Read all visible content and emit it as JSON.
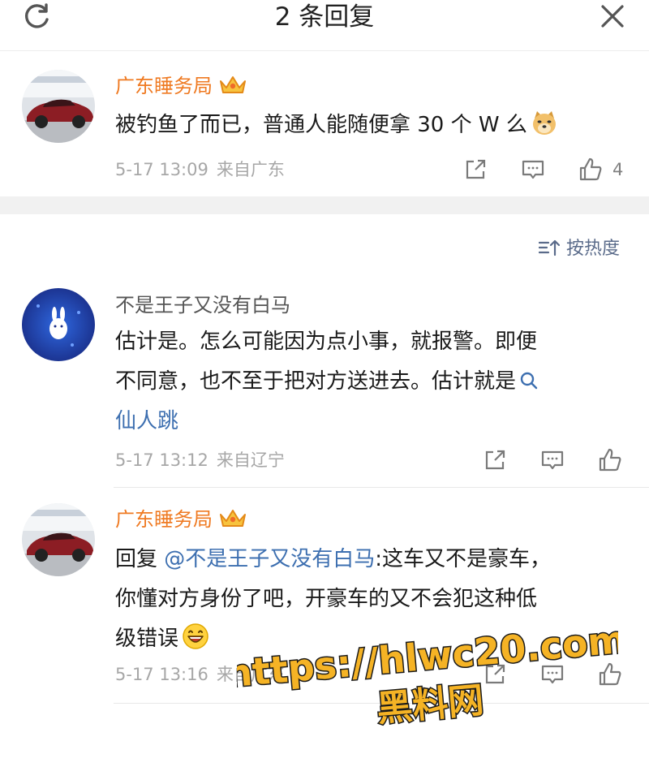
{
  "header": {
    "title": "2 条回复"
  },
  "main_comment": {
    "username": "广东睡务局",
    "text": "被钓鱼了而已，普通人能随便拿 30 个 W 么",
    "time": "5-17 13:09",
    "source": "来自广东",
    "like_count": "4"
  },
  "sort": {
    "label": "按热度"
  },
  "replies": [
    {
      "username": "不是王子又没有白马",
      "text_line1": "估计是。怎么可能因为点小事，就报警。即便",
      "text_line2": "不同意，也不至于把对方送进去。估计就是",
      "search_link": "仙人跳",
      "time": "5-17 13:12",
      "source": "来自辽宁"
    },
    {
      "username": "广东睡务局",
      "reply_prefix": "回复",
      "mention": "@不是王子又没有白马",
      "text_line1": ":这车又不是豪车，",
      "text_line2": "你懂对方身份了吧，开豪车的又不会犯这种低",
      "text_line3": "级错误",
      "time": "5-17 13:16",
      "source": "来自广东"
    }
  ],
  "watermark": {
    "line1": "https://hlwc20.com",
    "line2": "黑料网"
  },
  "colors": {
    "username_orange": "#ef7a22",
    "link_blue": "#3d6fb0",
    "meta_gray": "#a7a7a7",
    "separator": "#f1f1f1"
  },
  "icons": [
    "refresh-icon",
    "close-icon",
    "crown-badge-icon",
    "doge-emoji",
    "laugh-emoji",
    "share-icon",
    "comment-icon",
    "like-icon",
    "sort-icon",
    "search-icon"
  ]
}
